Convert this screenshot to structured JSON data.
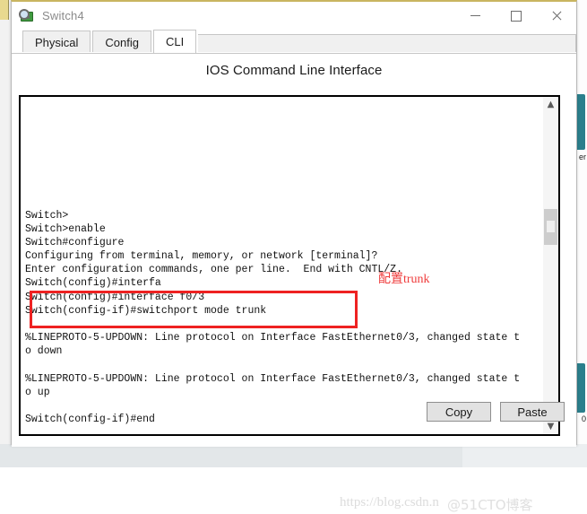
{
  "window": {
    "title": "Switch4",
    "icon": "switch-magnifier-icon",
    "controls": {
      "minimize": "minimize-icon",
      "maximize": "maximize-icon",
      "close": "close-icon"
    }
  },
  "tabs": [
    {
      "label": "Physical",
      "active": false
    },
    {
      "label": "Config",
      "active": false
    },
    {
      "label": "CLI",
      "active": true
    }
  ],
  "panel": {
    "title": "IOS Command Line Interface"
  },
  "terminal": {
    "lines": [
      "",
      "",
      "",
      "",
      "",
      "",
      "",
      "",
      "Switch>",
      "Switch>enable",
      "Switch#configure",
      "Configuring from terminal, memory, or network [terminal]?",
      "Enter configuration commands, one per line.  End with CNTL/Z.",
      "Switch(config)#interfa",
      "Switch(config)#interface f0/3",
      "Switch(config-if)#switchport mode trunk",
      "",
      "%LINEPROTO-5-UPDOWN: Line protocol on Interface FastEthernet0/3, changed state t",
      "o down",
      "",
      "%LINEPROTO-5-UPDOWN: Line protocol on Interface FastEthernet0/3, changed state t",
      "o up",
      "",
      "Switch(config-if)#end"
    ],
    "scrollbar": {
      "up": "▲",
      "down": "▼"
    }
  },
  "annotation": {
    "text_cn": "配置",
    "text_en": "trunk",
    "color": "#ef3b3b",
    "box_color": "#ee2222"
  },
  "buttons": [
    {
      "label": "Copy",
      "name": "copy-button"
    },
    {
      "label": "Paste",
      "name": "paste-button"
    }
  ],
  "watermarks": {
    "url": "https://blog.csdn.n",
    "site": "@51CTO博客"
  },
  "background": {
    "device_label_1": "er",
    "device_label_2": "0"
  }
}
